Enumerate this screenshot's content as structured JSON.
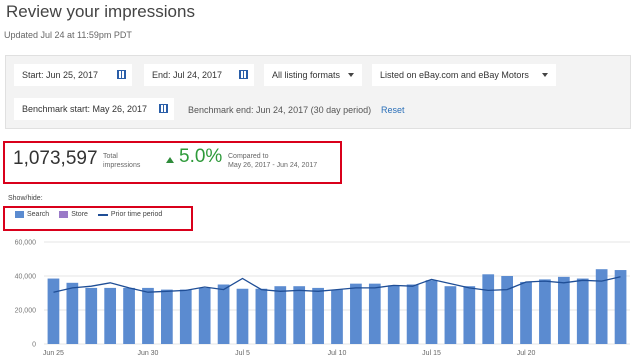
{
  "header": {
    "title": "Review your impressions",
    "updated": "Updated Jul 24 at 11:59pm PDT"
  },
  "filters": {
    "start": "Start: Jun 25, 2017",
    "end": "End: Jul 24, 2017",
    "formats": "All listing formats",
    "listed_on": "Listed on eBay.com and eBay Motors",
    "benchmark_start": "Benchmark start: May 26, 2017",
    "benchmark_end": "Benchmark end: Jun 24, 2017 (30 day period)",
    "reset": "Reset"
  },
  "summary": {
    "total": "1,073,597",
    "total_label_1": "Total",
    "total_label_2": "impressions",
    "change": "5.0%",
    "compared_1": "Compared to",
    "compared_2": "May 26, 2017 - Jun 24, 2017"
  },
  "showhide": {
    "label": "Show/hide:",
    "search": "Search",
    "store": "Store",
    "prior": "Prior time period"
  },
  "colors": {
    "bar": "#5b8bd0",
    "store": "#9a7ac8",
    "line": "#1f4e96",
    "accent_red": "#d9001b",
    "green": "#2e9a3a"
  },
  "chart_data": {
    "type": "bar",
    "ylim": [
      0,
      60000
    ],
    "yticks": [
      "60,000",
      "40,000",
      "20,000",
      "0"
    ],
    "ytick_values": [
      60000,
      40000,
      20000,
      0
    ],
    "xtick_labels": [
      "Jun 25",
      "Jun 30",
      "Jul 5",
      "Jul 10",
      "Jul 15",
      "Jul 20"
    ],
    "xtick_index": [
      0,
      5,
      10,
      15,
      20,
      25
    ],
    "series": [
      {
        "name": "Search",
        "values": [
          38500,
          36000,
          33000,
          33000,
          33000,
          33000,
          32000,
          32000,
          33000,
          35000,
          32500,
          32500,
          34000,
          34000,
          33000,
          32000,
          35500,
          35500,
          34500,
          35000,
          37500,
          34000,
          34000,
          41000,
          40000,
          36500,
          38000,
          39500,
          38500,
          44000,
          43500
        ]
      },
      {
        "name": "Prior time period",
        "values": [
          30500,
          33000,
          34000,
          36000,
          33000,
          30500,
          31000,
          31500,
          33500,
          32000,
          38500,
          32000,
          31000,
          31500,
          31000,
          32000,
          33000,
          33000,
          34500,
          34000,
          38000,
          35500,
          33000,
          31500,
          32000,
          36500,
          37000,
          36000,
          37500,
          37000,
          39500
        ]
      }
    ]
  }
}
